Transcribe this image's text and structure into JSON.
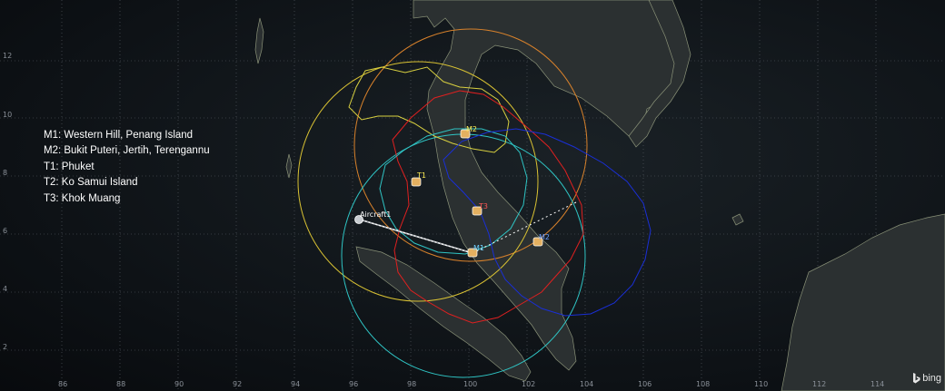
{
  "legend": [
    "M1: Western Hill, Penang Island",
    "M2: Bukit Puteri, Jertih, Terengannu",
    "T1: Phuket",
    "T2: Ko Samui Island",
    "T3: Khok Muang"
  ],
  "x_ticks": [
    "86",
    "88",
    "90",
    "92",
    "94",
    "96",
    "98",
    "100",
    "102",
    "104",
    "106",
    "108",
    "110",
    "112",
    "114"
  ],
  "y_ticks": [
    "12",
    "10",
    "8",
    "6",
    "4",
    "2"
  ],
  "sites": [
    {
      "id": "M1",
      "label": "M1",
      "color": "#6fd0ff"
    },
    {
      "id": "M2",
      "label": "M2",
      "color": "#6fa0ff"
    },
    {
      "id": "T1",
      "label": "T1",
      "color": "#ffee55"
    },
    {
      "id": "T2",
      "label": "T2",
      "color": "#ffee55"
    },
    {
      "id": "T3",
      "label": "T3",
      "color": "#ff5555"
    }
  ],
  "aircraft": {
    "label": "Aircraft1"
  },
  "attribution": "bing",
  "colors": {
    "orange_ring": "#d9822b",
    "yellow_ring": "#d9c233",
    "cyan_ring": "#2fc4c4",
    "red_coverage": "#e02020",
    "blue_coverage": "#1a2fd6",
    "yellow_coverage": "#d8d040",
    "land": "#2b3031",
    "coast": "#8a9278"
  }
}
